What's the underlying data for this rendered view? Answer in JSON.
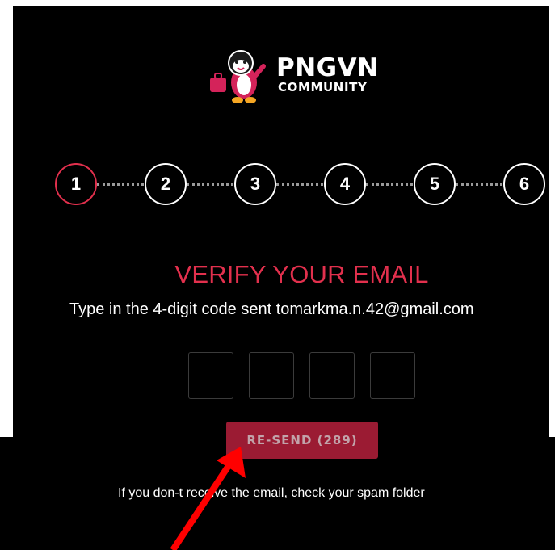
{
  "brand": {
    "title": "PNGVN",
    "subtitle": "COMMUNITY",
    "mascot_icon": "penguin-mascot-icon"
  },
  "steps": {
    "items": [
      "1",
      "2",
      "3",
      "4",
      "5",
      "6"
    ],
    "active_step": 1
  },
  "verify": {
    "heading": "VERIFY YOUR EMAIL",
    "instruction": "Type in the 4-digit code sent tomarkma.n.42@gmail.com"
  },
  "code": {
    "digits": [
      "",
      "",
      "",
      ""
    ]
  },
  "resend": {
    "label": "RE-SEND (289)"
  },
  "footer": {
    "spam_note": "If you don-t receive the email, check your spam folder"
  },
  "annotation": {
    "icon": "red-arrow-icon",
    "color": "#ff0000"
  },
  "colors": {
    "accent": "#e2304d",
    "button_bg": "#9b1b33",
    "background": "#000000"
  }
}
